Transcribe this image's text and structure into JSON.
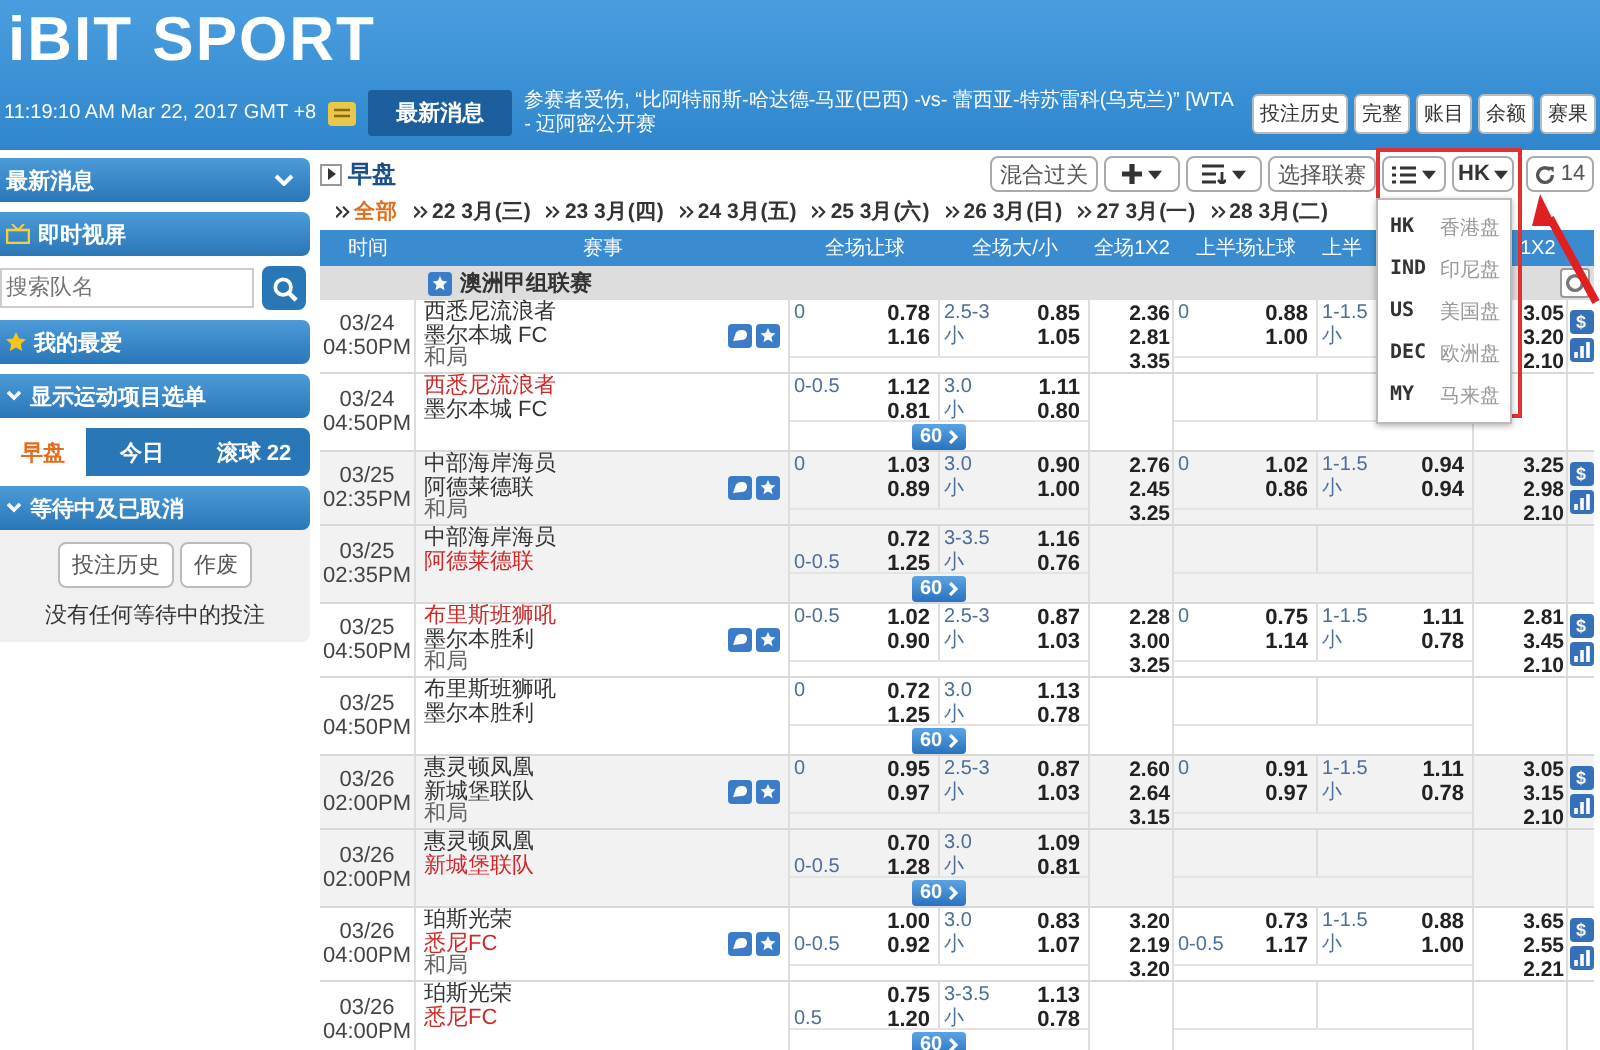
{
  "header": {
    "logo": "iBIT SPORT",
    "clock": "11:19:10 AM Mar 22, 2017 GMT +8",
    "news_tab": "最新消息",
    "ticker": "参赛者受伤, “比阿特丽斯-哈达德-马亚(巴西) -vs- 蕾西亚-特苏雷科(乌克兰)” [WTA - 迈阿密公开赛",
    "buttons": [
      "投注历史",
      "完整",
      "账目",
      "余额",
      "赛果"
    ]
  },
  "sidebar": {
    "news": "最新消息",
    "live": "即时视屏",
    "search": {
      "placeholder": "搜索队名"
    },
    "favorites": "我的最爱",
    "sports_menu": "显示运动项目选单",
    "tabs": [
      {
        "label": "早盘",
        "selected": true
      },
      {
        "label": "今日",
        "selected": false
      },
      {
        "label": "滚球 22",
        "selected": false
      }
    ],
    "pending": {
      "title": "等待中及已取消",
      "buttons": [
        "投注历史",
        "作废"
      ],
      "message": "没有任何等待中的投注"
    }
  },
  "market": {
    "title": "早盘",
    "buttons": [
      {
        "kind": "text",
        "label": "混合过关"
      },
      {
        "kind": "add"
      },
      {
        "kind": "sort"
      },
      {
        "kind": "text",
        "label": "选择联赛"
      },
      {
        "kind": "list"
      },
      {
        "kind": "odds",
        "label": "HK"
      },
      {
        "kind": "refresh",
        "label": "14"
      }
    ],
    "odds_menu": [
      {
        "code": "HK",
        "label": "香港盘"
      },
      {
        "code": "IND",
        "label": "印尼盘"
      },
      {
        "code": "US",
        "label": "美国盘"
      },
      {
        "code": "DEC",
        "label": "欧洲盘"
      },
      {
        "code": "MY",
        "label": "马来盘"
      }
    ],
    "dates": [
      {
        "label": "全部",
        "selected": true
      },
      {
        "label": "22 3月(三)",
        "selected": false
      },
      {
        "label": "23 3月(四)",
        "selected": false
      },
      {
        "label": "24 3月(五)",
        "selected": false
      },
      {
        "label": "25 3月(六)",
        "selected": false
      },
      {
        "label": "26 3月(日)",
        "selected": false
      },
      {
        "label": "27 3月(一)",
        "selected": false
      },
      {
        "label": "28 3月(二)",
        "selected": false
      }
    ]
  },
  "table": {
    "columns": [
      "时间",
      "赛事",
      "全场让球",
      "全场大/小",
      "全场1X2",
      "上半场让球",
      "上半",
      "1X2"
    ],
    "league": "澳洲甲组联赛",
    "matches": [
      {
        "kind": "main",
        "date": "03/24",
        "time": "04:50PM",
        "home": {
          "name": "西悉尼流浪者",
          "favored": false
        },
        "away": {
          "name": "墨尔本城 FC",
          "favored": false
        },
        "draw": "和局",
        "handicap": {
          "line": "0",
          "odds": [
            "0.78",
            "1.16"
          ]
        },
        "over_under": {
          "line": "2.5-3",
          "side": "小",
          "odds": [
            "0.85",
            "1.05"
          ]
        },
        "one_x_two": [
          "2.36",
          "2.81",
          "3.35"
        ],
        "first_half": {
          "handicap": {
            "line": "0",
            "odds": [
              "0.88",
              "1.00"
            ]
          },
          "over_under": {
            "line": "1-1.5",
            "side": "小"
          },
          "one_x_two": [
            "3.05",
            "3.20",
            "2.10"
          ]
        },
        "stake_sign": "$"
      },
      {
        "kind": "alt",
        "date": "03/24",
        "time": "04:50PM",
        "home": {
          "name": "西悉尼流浪者",
          "favored": true
        },
        "away": {
          "name": "墨尔本城 FC",
          "favored": false
        },
        "handicap": {
          "line": "0-0.5",
          "odds": [
            "1.12",
            "0.81"
          ]
        },
        "over_under": {
          "line": "3.0",
          "side": "小",
          "odds": [
            "1.11",
            "0.80"
          ]
        },
        "more": "60"
      },
      {
        "kind": "main",
        "date": "03/25",
        "time": "02:35PM",
        "home": {
          "name": "中部海岸海员",
          "favored": false
        },
        "away": {
          "name": "阿德莱德联",
          "favored": false
        },
        "draw": "和局",
        "handicap": {
          "line": "0",
          "odds": [
            "1.03",
            "0.89"
          ]
        },
        "over_under": {
          "line": "3.0",
          "side": "小",
          "odds": [
            "0.90",
            "1.00"
          ]
        },
        "one_x_two": [
          "2.76",
          "2.45",
          "3.25"
        ],
        "first_half": {
          "handicap": {
            "line": "0",
            "odds": [
              "1.02",
              "0.86"
            ]
          },
          "over_under": {
            "line": "1-1.5",
            "side": "小",
            "odds": [
              "0.94",
              "0.94"
            ]
          },
          "one_x_two": [
            "3.25",
            "2.98",
            "2.10"
          ]
        },
        "stake_sign": "$"
      },
      {
        "kind": "alt",
        "date": "03/25",
        "time": "02:35PM",
        "home": {
          "name": "中部海岸海员",
          "favored": false
        },
        "away": {
          "name": "阿德莱德联",
          "favored": true
        },
        "handicap": {
          "line": "0-0.5",
          "odds": [
            "0.72",
            "1.25"
          ]
        },
        "over_under": {
          "line": "3-3.5",
          "side": "小",
          "odds": [
            "1.16",
            "0.76"
          ]
        },
        "more": "60"
      },
      {
        "kind": "main",
        "date": "03/25",
        "time": "04:50PM",
        "home": {
          "name": "布里斯班狮吼",
          "favored": true
        },
        "away": {
          "name": "墨尔本胜利",
          "favored": false
        },
        "draw": "和局",
        "handicap": {
          "line": "0-0.5",
          "odds": [
            "1.02",
            "0.90"
          ]
        },
        "over_under": {
          "line": "2.5-3",
          "side": "小",
          "odds": [
            "0.87",
            "1.03"
          ]
        },
        "one_x_two": [
          "2.28",
          "3.00",
          "3.25"
        ],
        "first_half": {
          "handicap": {
            "line": "0",
            "odds": [
              "0.75",
              "1.14"
            ]
          },
          "over_under": {
            "line": "1-1.5",
            "side": "小",
            "odds": [
              "1.11",
              "0.78"
            ]
          },
          "one_x_two": [
            "2.81",
            "3.45",
            "2.10"
          ]
        },
        "stake_sign": "$"
      },
      {
        "kind": "alt",
        "date": "03/25",
        "time": "04:50PM",
        "home": {
          "name": "布里斯班狮吼",
          "favored": false
        },
        "away": {
          "name": "墨尔本胜利",
          "favored": false
        },
        "handicap": {
          "line": "0",
          "odds": [
            "0.72",
            "1.25"
          ]
        },
        "over_under": {
          "line": "3.0",
          "side": "小",
          "odds": [
            "1.13",
            "0.78"
          ]
        },
        "more": "60"
      },
      {
        "kind": "main",
        "date": "03/26",
        "time": "02:00PM",
        "home": {
          "name": "惠灵顿凤凰",
          "favored": false
        },
        "away": {
          "name": "新城堡联队",
          "favored": false
        },
        "draw": "和局",
        "handicap": {
          "line": "0",
          "odds": [
            "0.95",
            "0.97"
          ]
        },
        "over_under": {
          "line": "2.5-3",
          "side": "小",
          "odds": [
            "0.87",
            "1.03"
          ]
        },
        "one_x_two": [
          "2.60",
          "2.64",
          "3.15"
        ],
        "first_half": {
          "handicap": {
            "line": "0",
            "odds": [
              "0.91",
              "0.97"
            ]
          },
          "over_under": {
            "line": "1-1.5",
            "side": "小",
            "odds": [
              "1.11",
              "0.78"
            ]
          },
          "one_x_two": [
            "3.05",
            "3.15",
            "2.10"
          ]
        },
        "stake_sign": "$"
      },
      {
        "kind": "alt",
        "date": "03/26",
        "time": "02:00PM",
        "home": {
          "name": "惠灵顿凤凰",
          "favored": false
        },
        "away": {
          "name": "新城堡联队",
          "favored": true
        },
        "handicap": {
          "line": "0-0.5",
          "odds": [
            "0.70",
            "1.28"
          ]
        },
        "over_under": {
          "line": "3.0",
          "side": "小",
          "odds": [
            "1.09",
            "0.81"
          ]
        },
        "more": "60"
      },
      {
        "kind": "main",
        "date": "03/26",
        "time": "04:00PM",
        "home": {
          "name": "珀斯光荣",
          "favored": false
        },
        "away": {
          "name": "悉尼FC",
          "favored": true
        },
        "draw": "和局",
        "handicap": {
          "line": "0-0.5",
          "odds": [
            "1.00",
            "0.92"
          ]
        },
        "over_under": {
          "line": "3.0",
          "side": "小",
          "odds": [
            "0.83",
            "1.07"
          ]
        },
        "one_x_two": [
          "3.20",
          "2.19",
          "3.20"
        ],
        "first_half": {
          "handicap": {
            "line": "0-0.5",
            "odds": [
              "0.73",
              "1.17"
            ]
          },
          "over_under": {
            "line": "1-1.5",
            "side": "小",
            "odds": [
              "0.88",
              "1.00"
            ]
          },
          "one_x_two": [
            "3.65",
            "2.55",
            "2.21"
          ]
        },
        "stake_sign": "$"
      },
      {
        "kind": "alt",
        "date": "03/26",
        "time": "04:00PM",
        "home": {
          "name": "珀斯光荣",
          "favored": false
        },
        "away": {
          "name": "悉尼FC",
          "favored": true
        },
        "handicap": {
          "line": "0.5",
          "odds": [
            "0.75",
            "1.20"
          ]
        },
        "over_under": {
          "line": "3-3.5",
          "side": "小",
          "odds": [
            "1.13",
            "0.78"
          ]
        },
        "more": "60"
      }
    ]
  }
}
